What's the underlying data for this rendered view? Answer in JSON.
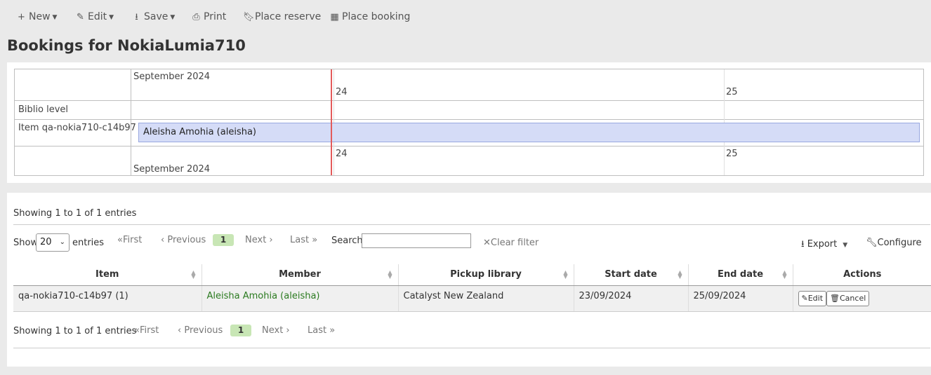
{
  "toolbar": {
    "new_label": "New",
    "edit_label": "Edit",
    "save_label": "Save",
    "print_label": "Print",
    "place_reserve_label": "Place reserve",
    "place_booking_label": "Place booking"
  },
  "page_title": "Bookings for NokiaLumia710",
  "timeline": {
    "month_top": "September 2024",
    "month_bottom": "September 2024",
    "day_24": "24",
    "day_25": "25",
    "groups": [
      "Biblio level",
      "Item qa-nokia710-c14b97"
    ],
    "booking_label": "Aleisha Amohia (aleisha)"
  },
  "table": {
    "info_top": "Showing 1 to 1 of 1 entries",
    "info_bottom": "Showing 1 to 1 of 1 entries",
    "show_label": "Show",
    "show_value": "20",
    "entries_label": "entries",
    "pagination": {
      "first": "First",
      "previous": "Previous",
      "current": "1",
      "next": "Next",
      "last": "Last"
    },
    "search_label": "Search:",
    "clear_filter": "Clear filter",
    "export_label": "Export",
    "configure_label": "Configure",
    "columns": [
      "Item",
      "Member",
      "Pickup library",
      "Start date",
      "End date",
      "Actions"
    ],
    "rows": [
      {
        "item": "qa-nokia710-c14b97 (1)",
        "member": "Aleisha Amohia (aleisha)",
        "pickup_library": "Catalyst New Zealand",
        "start_date": "23/09/2024",
        "end_date": "25/09/2024",
        "edit_label": "Edit",
        "cancel_label": "Cancel"
      }
    ]
  }
}
